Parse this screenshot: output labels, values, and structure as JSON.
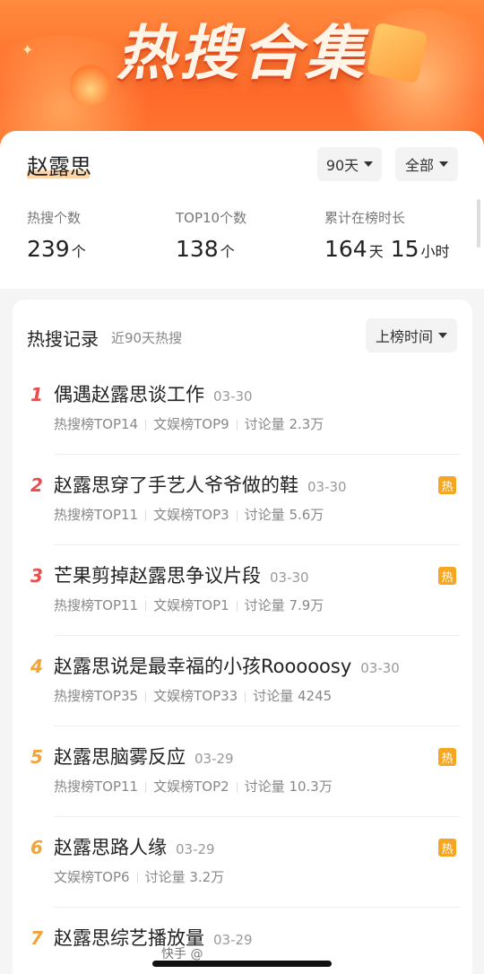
{
  "banner": {
    "title": "热搜合集"
  },
  "profile": {
    "name": "赵露思",
    "range_filter": "90天",
    "category_filter": "全部"
  },
  "stats": {
    "hot_count": {
      "label": "热搜个数",
      "value": "239",
      "unit": "个"
    },
    "top10_count": {
      "label": "TOP10个数",
      "value": "138",
      "unit": "个"
    },
    "duration": {
      "label": "累计在榜时长",
      "days": "164",
      "day_unit": "天",
      "hours": "15",
      "hour_unit": "小时"
    }
  },
  "records": {
    "title": "热搜记录",
    "subtitle": "近90天热搜",
    "sort_label": "上榜时间",
    "rank_colors": {
      "top": "#e94e4e",
      "rest": "#f0a43a"
    },
    "items": [
      {
        "rank": "1",
        "title": "偶遇赵露思谈工作",
        "date": "03-30",
        "meta": [
          "热搜榜TOP14",
          "文娱榜TOP9",
          "讨论量 2.3万"
        ],
        "hot": false
      },
      {
        "rank": "2",
        "title": "赵露思穿了手艺人爷爷做的鞋",
        "date": "03-30",
        "meta": [
          "热搜榜TOP11",
          "文娱榜TOP3",
          "讨论量 5.6万"
        ],
        "hot": true
      },
      {
        "rank": "3",
        "title": "芒果剪掉赵露思争议片段",
        "date": "03-30",
        "meta": [
          "热搜榜TOP11",
          "文娱榜TOP1",
          "讨论量 7.9万"
        ],
        "hot": true
      },
      {
        "rank": "4",
        "title": "赵露思说是最幸福的小孩Rooooosy",
        "date": "03-30",
        "meta": [
          "热搜榜TOP35",
          "文娱榜TOP33",
          "讨论量 4245"
        ],
        "hot": false
      },
      {
        "rank": "5",
        "title": "赵露思脑雾反应",
        "date": "03-29",
        "meta": [
          "热搜榜TOP11",
          "文娱榜TOP2",
          "讨论量 10.3万"
        ],
        "hot": true
      },
      {
        "rank": "6",
        "title": "赵露思路人缘",
        "date": "03-29",
        "meta": [
          "文娱榜TOP6",
          "讨论量 3.2万"
        ],
        "hot": true
      },
      {
        "rank": "7",
        "title": "赵露思综艺播放量",
        "date": "03-29",
        "meta": [],
        "hot": false
      }
    ],
    "hot_badge": "热"
  },
  "watermark": "快手 @"
}
